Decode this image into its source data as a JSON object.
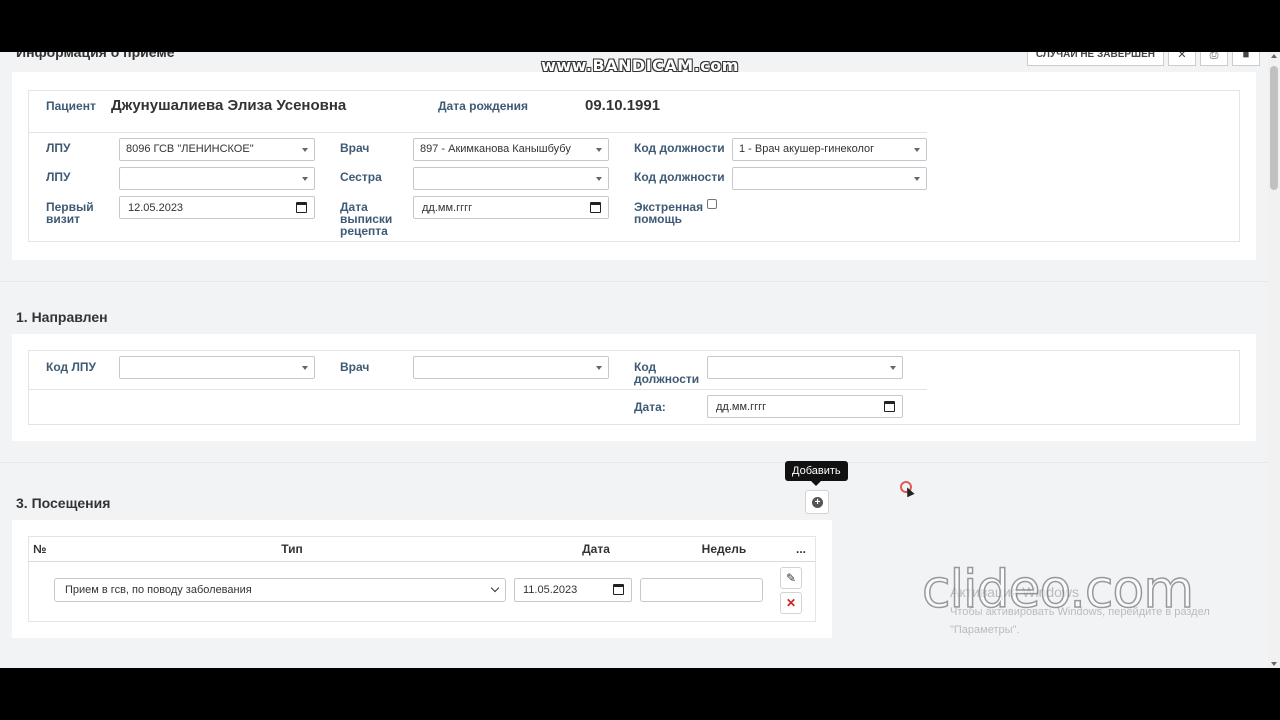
{
  "recording_watermark": "www.BANDICAM.com",
  "header": {
    "title": "Информация о приеме",
    "status_button": "СЛУЧАЙ НЕ ЗАВЕРШЕН"
  },
  "patient": {
    "label": "Пациент",
    "name": "Джунушалиева Элиза Усеновна",
    "dob_label": "Дата рождения",
    "dob": "09.10.1991"
  },
  "form": {
    "lpu_label": "ЛПУ",
    "lpu_value": "8096 ГСВ \"ЛЕНИНСКОЕ\"",
    "doctor_label": "Врач",
    "doctor_value": "897 - Акимканова Канышбубу",
    "position_label": "Код должности",
    "position_value": "1 - Врач акушер-гинеколог",
    "lpu2_label": "ЛПУ",
    "nurse_label": "Сестра",
    "position2_label": "Код должности",
    "first_visit_label_1": "Первый",
    "first_visit_label_2": "визит",
    "first_visit_value": "12.05.2023",
    "rx_date_label_1": "Дата",
    "rx_date_label_2": "выписки",
    "rx_date_label_3": "рецепта",
    "rx_date_placeholder": "дд.мм.гггг",
    "emergency_label_1": "Экстренная",
    "emergency_label_2": "помощь"
  },
  "section1": {
    "title": "1. Направлен",
    "lpu_code_label": "Код ЛПУ",
    "doctor_label": "Врач",
    "position_label_1": "Код",
    "position_label_2": "должности",
    "date_label": "Дата:",
    "date_placeholder": "дд.мм.гггг"
  },
  "section3": {
    "title": "3. Посещения",
    "tooltip": "Добавить",
    "columns": [
      "№",
      "Тип",
      "Дата",
      "Недель",
      "..."
    ],
    "rows": [
      {
        "type": "Прием в гсв, по поводу заболевания",
        "date": "11.05.2023",
        "weeks": ""
      }
    ]
  },
  "overlay": {
    "clideo": "clideo.com",
    "activate_1": "Активация Windows",
    "activate_2": "Чтобы активировать Windows, перейдите в раздел",
    "activate_3": "\"Параметры\"."
  }
}
